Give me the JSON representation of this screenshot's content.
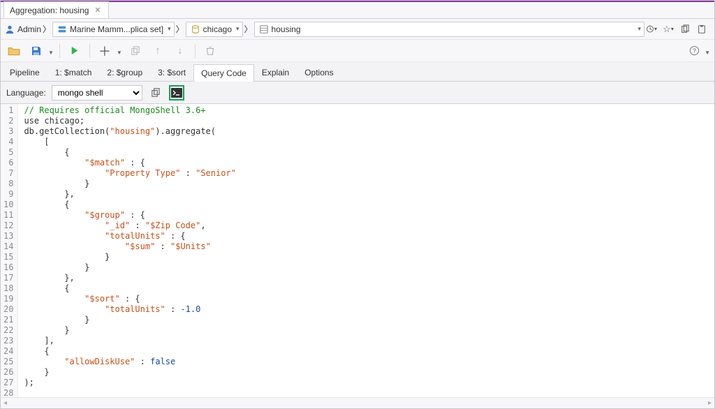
{
  "window": {
    "tab_title": "Aggregation: housing"
  },
  "breadcrumb": {
    "user": "Admin",
    "server": "Marine Mamm...plica set]",
    "database": "chicago",
    "collection": "housing"
  },
  "tabs": [
    {
      "label": "Pipeline"
    },
    {
      "label": "1: $match"
    },
    {
      "label": "2: $group"
    },
    {
      "label": "3: $sort"
    },
    {
      "label": "Query Code",
      "active": true
    },
    {
      "label": "Explain"
    },
    {
      "label": "Options"
    }
  ],
  "language_bar": {
    "label": "Language:",
    "selected": "mongo shell"
  },
  "code": {
    "lines": [
      {
        "n": 1,
        "segs": [
          {
            "t": "// Requires official MongoShell 3.6+",
            "c": "tok-comment"
          }
        ]
      },
      {
        "n": 2,
        "segs": [
          {
            "t": "use chicago;",
            "c": "tok-ident"
          }
        ]
      },
      {
        "n": 3,
        "segs": [
          {
            "t": "db.getCollection(",
            "c": "tok-ident"
          },
          {
            "t": "\"housing\"",
            "c": "tok-str"
          },
          {
            "t": ").aggregate(",
            "c": "tok-ident"
          }
        ]
      },
      {
        "n": 4,
        "segs": [
          {
            "t": "    [",
            "c": "tok-punct"
          }
        ]
      },
      {
        "n": 5,
        "segs": [
          {
            "t": "        {",
            "c": "tok-punct"
          }
        ]
      },
      {
        "n": 6,
        "segs": [
          {
            "t": "            ",
            "c": ""
          },
          {
            "t": "\"$match\"",
            "c": "tok-str"
          },
          {
            "t": " : {",
            "c": "tok-punct"
          }
        ]
      },
      {
        "n": 7,
        "segs": [
          {
            "t": "                ",
            "c": ""
          },
          {
            "t": "\"Property Type\"",
            "c": "tok-str"
          },
          {
            "t": " : ",
            "c": "tok-punct"
          },
          {
            "t": "\"Senior\"",
            "c": "tok-str"
          }
        ]
      },
      {
        "n": 8,
        "segs": [
          {
            "t": "            }",
            "c": "tok-punct"
          }
        ]
      },
      {
        "n": 9,
        "segs": [
          {
            "t": "        },",
            "c": "tok-punct"
          }
        ]
      },
      {
        "n": 10,
        "segs": [
          {
            "t": "        {",
            "c": "tok-punct"
          }
        ]
      },
      {
        "n": 11,
        "segs": [
          {
            "t": "            ",
            "c": ""
          },
          {
            "t": "\"$group\"",
            "c": "tok-str"
          },
          {
            "t": " : {",
            "c": "tok-punct"
          }
        ]
      },
      {
        "n": 12,
        "segs": [
          {
            "t": "                ",
            "c": ""
          },
          {
            "t": "\"_id\"",
            "c": "tok-str"
          },
          {
            "t": " : ",
            "c": "tok-punct"
          },
          {
            "t": "\"$Zip Code\"",
            "c": "tok-str"
          },
          {
            "t": ",",
            "c": "tok-punct"
          }
        ]
      },
      {
        "n": 13,
        "segs": [
          {
            "t": "                ",
            "c": ""
          },
          {
            "t": "\"totalUnits\"",
            "c": "tok-str"
          },
          {
            "t": " : {",
            "c": "tok-punct"
          }
        ]
      },
      {
        "n": 14,
        "segs": [
          {
            "t": "                    ",
            "c": ""
          },
          {
            "t": "\"$sum\"",
            "c": "tok-str"
          },
          {
            "t": " : ",
            "c": "tok-punct"
          },
          {
            "t": "\"$Units\"",
            "c": "tok-str"
          }
        ]
      },
      {
        "n": 15,
        "segs": [
          {
            "t": "                }",
            "c": "tok-punct"
          }
        ]
      },
      {
        "n": 16,
        "segs": [
          {
            "t": "            }",
            "c": "tok-punct"
          }
        ]
      },
      {
        "n": 17,
        "segs": [
          {
            "t": "        },",
            "c": "tok-punct"
          }
        ]
      },
      {
        "n": 18,
        "segs": [
          {
            "t": "        {",
            "c": "tok-punct"
          }
        ]
      },
      {
        "n": 19,
        "segs": [
          {
            "t": "            ",
            "c": ""
          },
          {
            "t": "\"$sort\"",
            "c": "tok-str"
          },
          {
            "t": " : {",
            "c": "tok-punct"
          }
        ]
      },
      {
        "n": 20,
        "segs": [
          {
            "t": "                ",
            "c": ""
          },
          {
            "t": "\"totalUnits\"",
            "c": "tok-str"
          },
          {
            "t": " : ",
            "c": "tok-punct"
          },
          {
            "t": "-1.0",
            "c": "tok-num"
          }
        ]
      },
      {
        "n": 21,
        "segs": [
          {
            "t": "            }",
            "c": "tok-punct"
          }
        ]
      },
      {
        "n": 22,
        "segs": [
          {
            "t": "        }",
            "c": "tok-punct"
          }
        ]
      },
      {
        "n": 23,
        "segs": [
          {
            "t": "    ],",
            "c": "tok-punct"
          }
        ]
      },
      {
        "n": 24,
        "segs": [
          {
            "t": "    {",
            "c": "tok-punct"
          }
        ]
      },
      {
        "n": 25,
        "segs": [
          {
            "t": "        ",
            "c": ""
          },
          {
            "t": "\"allowDiskUse\"",
            "c": "tok-str"
          },
          {
            "t": " : ",
            "c": "tok-punct"
          },
          {
            "t": "false",
            "c": "tok-kw"
          }
        ]
      },
      {
        "n": 26,
        "segs": [
          {
            "t": "    }",
            "c": "tok-punct"
          }
        ]
      },
      {
        "n": 27,
        "segs": [
          {
            "t": ");",
            "c": "tok-punct"
          }
        ]
      },
      {
        "n": 28,
        "segs": [
          {
            "t": "",
            "c": ""
          }
        ]
      }
    ]
  }
}
